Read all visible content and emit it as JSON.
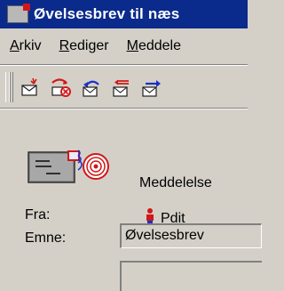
{
  "window": {
    "title": "Øvelsesbrev til næs",
    "icon": "mail-window-icon"
  },
  "menu": {
    "items": [
      {
        "label": "Arkiv",
        "underline": "A",
        "rest": "rkiv"
      },
      {
        "label": "Rediger",
        "underline": "R",
        "rest": "ediger"
      },
      {
        "label": "Meddelelse",
        "underline": "M",
        "rest": "eddele"
      }
    ]
  },
  "toolbar": {
    "buttons": [
      {
        "icon": "new-message-icon"
      },
      {
        "icon": "delete-icon"
      },
      {
        "icon": "reply-icon"
      },
      {
        "icon": "reply-all-icon"
      },
      {
        "icon": "forward-icon"
      }
    ]
  },
  "header": {
    "type_label": "Meddelelse",
    "from_label": "Fra:",
    "from_value": "Pdit",
    "subject_label": "Emne:",
    "subject_value": "Øvelsesbrev"
  },
  "colors": {
    "titlebar": "#0a2a8c",
    "face": "#d4d0c8",
    "accent_red": "#d01818"
  }
}
